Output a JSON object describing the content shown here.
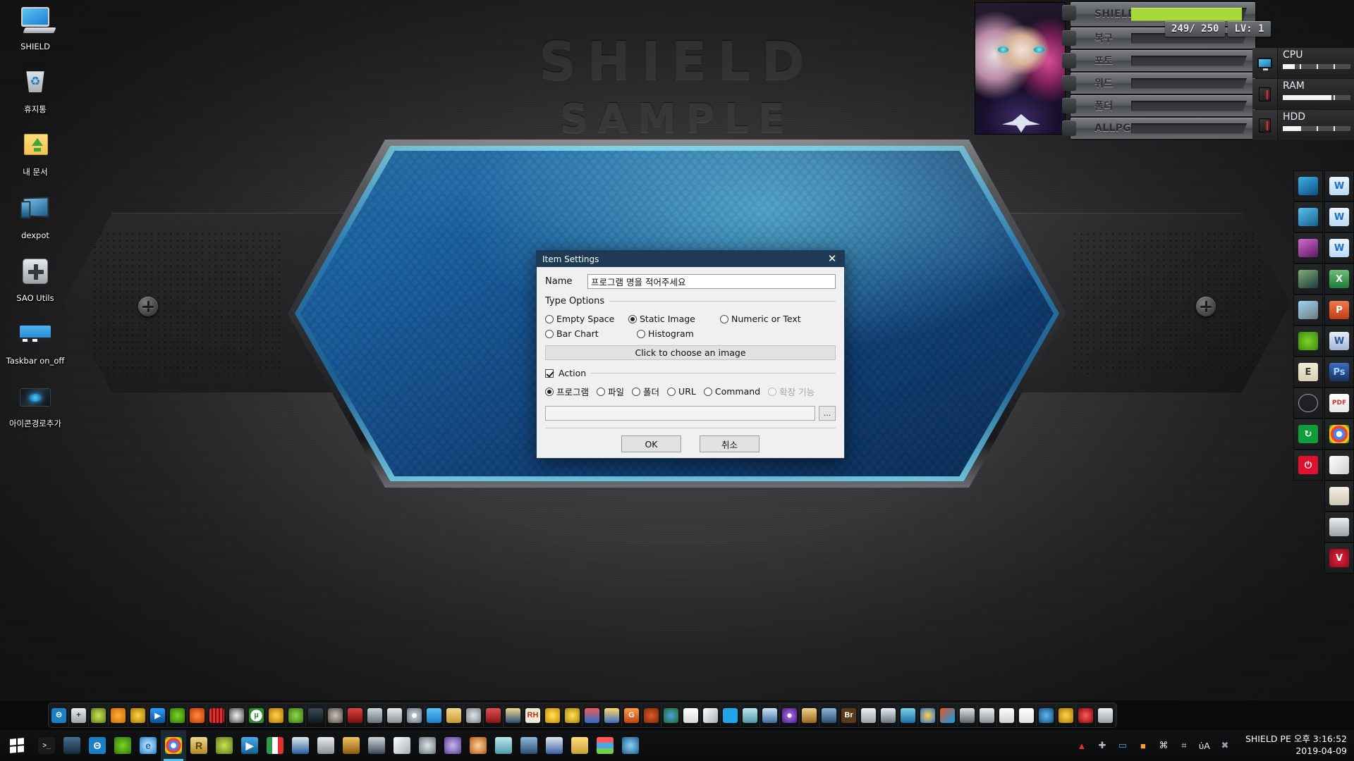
{
  "wallpaper": {
    "title_line1": "SHIELD",
    "title_line2": "SAMPLE"
  },
  "desktop_icons": [
    {
      "label": "SHIELD",
      "icon": "computer-icon",
      "cls": "ic-monitor"
    },
    {
      "label": "휴지통",
      "icon": "recycle-bin-icon",
      "cls": "ic-trash"
    },
    {
      "label": "내 문서",
      "icon": "documents-folder-icon",
      "cls": "ic-folderup"
    },
    {
      "label": "dexpot",
      "icon": "dexpot-icon",
      "cls": "ic-dexpot"
    },
    {
      "label": "SAO Utils",
      "icon": "plus-icon",
      "cls": "ic-plus"
    },
    {
      "label": "Taskbar on_off",
      "icon": "taskbar-toggle-icon",
      "cls": "ic-taskbar"
    },
    {
      "label": "아이콘경로추가",
      "icon": "icon-path-add-icon",
      "cls": "ic-pathadd"
    }
  ],
  "widget": {
    "bars": [
      {
        "name": "SHIELD",
        "fill_percent": 96,
        "color": "#a9d939",
        "shield": true
      },
      {
        "name": "복구",
        "fill_percent": 0,
        "color": "#a9d939",
        "shield": false
      },
      {
        "name": "포토",
        "fill_percent": 0,
        "color": "#a9d939",
        "shield": false
      },
      {
        "name": "워드",
        "fill_percent": 0,
        "color": "#a9d939",
        "shield": false
      },
      {
        "name": "폴더",
        "fill_percent": 0,
        "color": "#a9d939",
        "shield": false
      },
      {
        "name": "ALLPG",
        "fill_percent": 0,
        "color": "#a9d939",
        "shield": false
      }
    ],
    "hp_value": "249/ 250",
    "level": "LV: 1",
    "sysmon": [
      {
        "label": "CPU",
        "icon": "monitor-icon",
        "fill_percent": 18
      },
      {
        "label": "RAM",
        "icon": "pc-tower-icon",
        "fill_percent": 72
      },
      {
        "label": "HDD",
        "icon": "pc-tower-icon",
        "fill_percent": 26
      }
    ]
  },
  "dock": {
    "col_a": [
      {
        "icon": "monitor-dark-icon",
        "bg": "linear-gradient(150deg,#3fb0ea,#0d4f80)"
      },
      {
        "icon": "multi-monitor-icon",
        "bg": "linear-gradient(150deg,#5cc0f0,#14628f)"
      },
      {
        "icon": "magenta-monitor-icon",
        "bg": "linear-gradient(150deg,#d46ad0,#5c1a63)"
      },
      {
        "icon": "landscape-photo-icon",
        "bg": "linear-gradient(150deg,#7fae7a,#1f3a3d)"
      },
      {
        "icon": "desktop-pc-icon",
        "bg": "linear-gradient(150deg,#9fd6f2,#6d7a84)"
      },
      {
        "icon": "clover-icon",
        "bg": "radial-gradient(circle,#7ed321,#3b8a12)"
      },
      {
        "icon": "e-tile-icon",
        "bg": "linear-gradient(#f2ecd8,#d8cfb2)",
        "text": "E",
        "textcolor": "#3a3326"
      },
      {
        "icon": "ellipse-outline-icon",
        "bg": "transparent"
      },
      {
        "icon": "restart-icon",
        "bg": "#0f9d3a",
        "text": "↻",
        "textcolor": "#ffffff"
      },
      {
        "icon": "shutdown-icon",
        "bg": "#e0102f",
        "text": "⏻",
        "textcolor": "#ffffff"
      }
    ],
    "col_b": [
      {
        "icon": "word-tile-icon",
        "bg": "linear-gradient(#eaf6ff,#b9dcf5)",
        "text": "W",
        "textcolor": "#1f6fc4"
      },
      {
        "icon": "word-tile-icon",
        "bg": "linear-gradient(#eaf6ff,#b9dcf5)",
        "text": "W",
        "textcolor": "#1f6fc4"
      },
      {
        "icon": "word-tile-icon",
        "bg": "linear-gradient(#eaf6ff,#b9dcf5)",
        "text": "W",
        "textcolor": "#1f6fc4"
      },
      {
        "icon": "excel-icon",
        "bg": "linear-gradient(#6fbf73,#1d7a3c)",
        "text": "X",
        "textcolor": "#ffffff"
      },
      {
        "icon": "powerpoint-icon",
        "bg": "linear-gradient(#f07a50,#c23b14)",
        "text": "P",
        "textcolor": "#ffffff"
      },
      {
        "icon": "word-doc-icon",
        "bg": "linear-gradient(#e8eef7,#9fb6d4)",
        "text": "W",
        "textcolor": "#2a5699"
      },
      {
        "icon": "photoshop-icon",
        "bg": "linear-gradient(#3c6fbd,#16305f)",
        "text": "Ps",
        "textcolor": "#9fd2ff"
      },
      {
        "icon": "pdf-icon",
        "bg": "linear-gradient(#ffffff,#e6e6e6)",
        "text": "PDF",
        "textcolor": "#d32f2f"
      },
      {
        "icon": "chrome-icon",
        "bg": "radial-gradient(circle at 50% 50%,#ffffff 22%,#4285f4 23% 42%,#ea4335 43% 62%,#fbbc05 63% 80%,#34a853 81%)"
      },
      {
        "icon": "everything-icon",
        "bg": "linear-gradient(135deg,#ffffff,#cfcfcf)"
      },
      {
        "icon": "folder-icon",
        "bg": "linear-gradient(#f5f0e4,#cfc7b3)"
      },
      {
        "icon": "drive-icon",
        "bg": "linear-gradient(#eceff1,#9aa0a6)"
      },
      {
        "icon": "v-shield-icon",
        "bg": "radial-gradient(circle,#e8243c,#8d0a1c)",
        "text": "V",
        "textcolor": "#ffffff"
      }
    ]
  },
  "taskbar": {
    "quick_launch": [
      {
        "icon": "shield-pe-icon",
        "bg": "#1b7fc4",
        "text": "Θ",
        "textcolor": "#ffffff"
      },
      {
        "icon": "sao-utils-icon",
        "bg": "linear-gradient(#e8ebee,#9fa4a9)",
        "text": "+",
        "textcolor": "#36393c"
      },
      {
        "icon": "olive-leaf-icon",
        "bg": "radial-gradient(circle,#cfe05a,#5f7d17)"
      },
      {
        "icon": "search-icon",
        "bg": "radial-gradient(circle,#ffb040,#d06a00)"
      },
      {
        "icon": "triangle-app-icon",
        "bg": "radial-gradient(circle,#ffd24a,#a87a00)"
      },
      {
        "icon": "play-live-icon",
        "bg": "linear-gradient(#2f9bff,#0a4f9e)",
        "text": "▶",
        "textcolor": "#ffffff"
      },
      {
        "icon": "clover-icon",
        "bg": "radial-gradient(circle,#7ed321,#2f7a0c)"
      },
      {
        "icon": "orange-swirl-icon",
        "bg": "radial-gradient(circle,#ff8b3d,#c23b00)"
      },
      {
        "icon": "red-grid-icon",
        "bg": "repeating-linear-gradient(90deg,#e03030 0 3px,#7a0d0d 3px 5px)"
      },
      {
        "icon": "tools-icon",
        "bg": "radial-gradient(circle,#f2f2f2,#4a4a4a)"
      },
      {
        "icon": "utorrent-icon",
        "bg": "radial-gradient(circle,#ffffff 55%,#2e8b2e 56%)",
        "text": "µ",
        "textcolor": "#2e8b2e"
      },
      {
        "icon": "magnifier-icon",
        "bg": "radial-gradient(circle,#ffd24a,#b37700)"
      },
      {
        "icon": "gear-green-icon",
        "bg": "radial-gradient(circle,#8ed64a,#3f7a14)"
      },
      {
        "icon": "blue-drop-icon",
        "bg": "linear-gradient(#3a4a55,#12181d)"
      },
      {
        "icon": "hdd-icon",
        "bg": "radial-gradient(circle,#c9c2b5,#5a5247)"
      },
      {
        "icon": "red-marker-icon",
        "bg": "linear-gradient(#e04040,#7a0f0f)"
      },
      {
        "icon": "win-flag-icon",
        "bg": "linear-gradient(#cfd6dc,#6a7480)"
      },
      {
        "icon": "usb-stick-icon",
        "bg": "linear-gradient(#e8ebee,#8c9196)"
      },
      {
        "icon": "disc-icon",
        "bg": "radial-gradient(circle,#ffffff 22%,#b8c4cc 23%,#6b7880)"
      },
      {
        "icon": "screen-icon",
        "bg": "linear-gradient(#5cc3f5,#1a7fd0)"
      },
      {
        "icon": "open-folder-icon",
        "bg": "linear-gradient(#f5d990,#c99b2f)"
      },
      {
        "icon": "lens-icon",
        "bg": "radial-gradient(circle,#dfe4e8,#7d858c)"
      },
      {
        "icon": "red-hand-icon",
        "bg": "linear-gradient(#e05050,#8a1414)"
      },
      {
        "icon": "hammer-icon",
        "bg": "linear-gradient(#f0d98a,#2a4d7a)"
      },
      {
        "icon": "resource-hacker-icon",
        "bg": "#efe9d8",
        "text": "RH",
        "textcolor": "#b03a1a"
      },
      {
        "icon": "flower-icon",
        "bg": "radial-gradient(circle,#ffe45c,#d08a00)"
      },
      {
        "icon": "yellow-char-icon",
        "bg": "radial-gradient(circle,#ffe45c,#b08200)"
      },
      {
        "icon": "puzzle-icon",
        "bg": "linear-gradient(#ef5a5a,#2e6ed0)"
      },
      {
        "icon": "wand-icon",
        "bg": "linear-gradient(#ffd966,#3a6fc4)"
      },
      {
        "icon": "g-app-icon",
        "bg": "linear-gradient(#ff9a4a,#c2450a)",
        "text": "G",
        "textcolor": "#ffffff"
      },
      {
        "icon": "green-check-icon",
        "bg": "radial-gradient(circle,#e05a2a,#7a2a0a)"
      },
      {
        "icon": "recycle-arrows-icon",
        "bg": "radial-gradient(circle,#4aa3e0,#1d6b2e)"
      },
      {
        "icon": "notepad-red-icon",
        "bg": "linear-gradient(#ffffff,#d8d8d8)"
      },
      {
        "icon": "diamond-icon",
        "bg": "linear-gradient(135deg,#ffffff,#a8b0b6)"
      },
      {
        "icon": "windows-tile-icon",
        "bg": "#20a6e8"
      },
      {
        "icon": "teal-book-icon",
        "bg": "linear-gradient(#bfe8ee,#4f9aa6)"
      },
      {
        "icon": "speaker-icon",
        "bg": "linear-gradient(#cfe4f5,#3a6f9e)"
      },
      {
        "icon": "disc-purple-icon",
        "bg": "radial-gradient(circle,#ffffff 20%,#9a5fd6 21%,#4a1f8a)"
      },
      {
        "icon": "archive-icon",
        "bg": "linear-gradient(#f0d08a,#9a6a1a)"
      },
      {
        "icon": "net-tool-icon",
        "bg": "linear-gradient(#8fb8dc,#2a4f73)"
      },
      {
        "icon": "bridge-icon",
        "bg": "#5a3a18",
        "text": "Br",
        "textcolor": "#ffffff"
      },
      {
        "icon": "backup-icon",
        "bg": "linear-gradient(#eef1f3,#9aa0a6)"
      },
      {
        "icon": "camera-icon",
        "bg": "linear-gradient(#e8eef3,#6a7480)"
      },
      {
        "icon": "triangle-logo-icon",
        "bg": "linear-gradient(#7fd0e8,#1a6fa8)"
      },
      {
        "icon": "gear-blue-icon",
        "bg": "radial-gradient(circle,#ffd24a,#2a6fd0)"
      },
      {
        "icon": "win-color-icon",
        "bg": "linear-gradient(135deg,#f25022,#00a4ef)"
      },
      {
        "icon": "printer-icon",
        "bg": "linear-gradient(#dfe4e8,#5a646c)"
      },
      {
        "icon": "clipboard-icon",
        "bg": "linear-gradient(#f0f3f5,#8a9096)"
      },
      {
        "icon": "white-box-icon",
        "bg": "linear-gradient(#ffffff,#cfcfcf)"
      },
      {
        "icon": "red-bar-icon",
        "bg": "linear-gradient(#ffffff,#e0e0e0)"
      },
      {
        "icon": "music-note-icon",
        "bg": "radial-gradient(circle,#5fb8f0,#14507f)"
      },
      {
        "icon": "yellow-gear-icon",
        "bg": "radial-gradient(circle,#ffd24a,#b07a00)"
      },
      {
        "icon": "shield-red-icon",
        "bg": "radial-gradient(circle,#ff5a5a,#8a0a0a)"
      },
      {
        "icon": "bowl-icon",
        "bg": "linear-gradient(#eef1f3,#9aa0a6)"
      }
    ],
    "apps": [
      {
        "icon": "cmd-icon",
        "bg": "#1a1a1a",
        "text": ">_",
        "textcolor": "#d0d0d0",
        "active": false
      },
      {
        "icon": "monitor-chart-icon",
        "bg": "linear-gradient(#4a6f8f,#16293c)",
        "active": false
      },
      {
        "icon": "shield-pe-icon",
        "bg": "#1b7fc4",
        "text": "Θ",
        "textcolor": "#ffffff",
        "active": false
      },
      {
        "icon": "clover-icon",
        "bg": "radial-gradient(circle,#7ed321,#2f7a0c)",
        "active": false
      },
      {
        "icon": "internet-explorer-icon",
        "bg": "radial-gradient(circle,#d8eefb,#1a7fd0)",
        "text": "e",
        "textcolor": "#1a6fb8",
        "active": false
      },
      {
        "icon": "chrome-icon",
        "bg": "radial-gradient(circle at 50% 50%,#ffffff 22%,#4285f4 23% 42%,#ea4335 43% 62%,#fbbc05 63% 80%,#34a853 81%)",
        "active": true
      },
      {
        "icon": "r-app-icon",
        "bg": "linear-gradient(#f0d98a,#b08a2a)",
        "text": "R",
        "textcolor": "#5a3a0a",
        "active": false
      },
      {
        "icon": "olive-leaf-icon",
        "bg": "radial-gradient(circle,#cfe05a,#5f7d17)",
        "active": false
      },
      {
        "icon": "media-player-icon",
        "bg": "linear-gradient(#4aa8e8,#14608f)",
        "text": "▶",
        "textcolor": "#ffffff",
        "active": false
      },
      {
        "icon": "italy-flag-icon",
        "bg": "linear-gradient(90deg,#2e9b4a 33%,#ffffff 33% 66%,#e03030 66%)",
        "active": false
      },
      {
        "icon": "blue-fold-icon",
        "bg": "linear-gradient(#dfe8f2,#2a5f9e)",
        "active": false
      },
      {
        "icon": "usb-stick-icon",
        "bg": "linear-gradient(#e8ebee,#8c9196)",
        "active": false
      },
      {
        "icon": "notebook-icon",
        "bg": "linear-gradient(#f0c860,#8a5a10)",
        "active": false
      },
      {
        "icon": "screen-dark-icon",
        "bg": "linear-gradient(#cfd6dc,#3a4a55)",
        "active": false
      },
      {
        "icon": "diamond-icon",
        "bg": "linear-gradient(135deg,#ffffff,#a8b0b6)",
        "active": false
      },
      {
        "icon": "magnifier-gray-icon",
        "bg": "radial-gradient(circle,#dfe4e8,#6a747c)",
        "active": false
      },
      {
        "icon": "disc-blue-icon",
        "bg": "radial-gradient(circle,#c8b8e8,#5a3f9e)",
        "active": false
      },
      {
        "icon": "disc-orange-icon",
        "bg": "radial-gradient(circle,#ffd0a0,#b05a10)",
        "active": false
      },
      {
        "icon": "teal-book-icon",
        "bg": "linear-gradient(#bfe8ee,#4f9aa6)",
        "active": false
      },
      {
        "icon": "net-tool-icon",
        "bg": "linear-gradient(#8fb8dc,#2a4f73)",
        "active": false
      },
      {
        "icon": "floppy-icon",
        "bg": "linear-gradient(#dfe8f5,#3a5f9e)",
        "active": false
      },
      {
        "icon": "folderup-icon",
        "bg": "linear-gradient(#ffdd7d,#c9a03a)",
        "active": false
      },
      {
        "icon": "colorbar-icon",
        "bg": "linear-gradient(#ff5a5a 33%,#4aa8e8 33% 66%,#6fcf4a 66%)",
        "active": false
      },
      {
        "icon": "globe-icon",
        "bg": "radial-gradient(circle,#8fd0f0,#1a5f8f)",
        "active": false
      }
    ],
    "tray": [
      {
        "icon": "mountain-red-icon",
        "color": "#e03030"
      },
      {
        "icon": "sao-plus-icon",
        "color": "#b8bcc0"
      },
      {
        "icon": "display-icon",
        "color": "#4aa8e8"
      },
      {
        "icon": "color-picker-icon",
        "color": "#ff9a3d"
      },
      {
        "icon": "usb-safe-icon",
        "color": "#e8ebee"
      },
      {
        "icon": "network-icon",
        "color": "#e8ebee"
      },
      {
        "icon": "volume-icon",
        "color": "#e8ebee"
      },
      {
        "icon": "close-tray-icon",
        "color": "#9aa0a6"
      }
    ],
    "clock_line1": "SHIELD PE 오후 3:16:52",
    "clock_line2": "2019-04-09"
  },
  "dialog": {
    "title": "Item Settings",
    "close_icon": "✕",
    "name_label": "Name",
    "name_value": "프로그램 명을 적어주세요",
    "name_placeholder": "프로그램 명을 적어주세요",
    "type_options_label": "Type Options",
    "type_options": [
      {
        "label": "Empty Space",
        "selected": false,
        "disabled": false
      },
      {
        "label": "Static Image",
        "selected": true,
        "disabled": false
      },
      {
        "label": "Numeric or Text",
        "selected": false,
        "disabled": false
      },
      {
        "label": "Bar Chart",
        "selected": false,
        "disabled": false
      },
      {
        "label": "Histogram",
        "selected": false,
        "disabled": false
      }
    ],
    "choose_image_label": "Click to choose an image",
    "action_label": "Action",
    "action_checked": true,
    "action_options": [
      {
        "label": "프로그램",
        "selected": true,
        "disabled": false
      },
      {
        "label": "파일",
        "selected": false,
        "disabled": false
      },
      {
        "label": "폴더",
        "selected": false,
        "disabled": false
      },
      {
        "label": "URL",
        "selected": false,
        "disabled": false
      },
      {
        "label": "Command",
        "selected": false,
        "disabled": false
      },
      {
        "label": "확장 기능",
        "selected": false,
        "disabled": true
      }
    ],
    "path_value": "",
    "path_placeholder": "",
    "browse_label": "...",
    "ok_label": "OK",
    "cancel_label": "취소",
    "titlebar_color": "#1f3a55"
  }
}
